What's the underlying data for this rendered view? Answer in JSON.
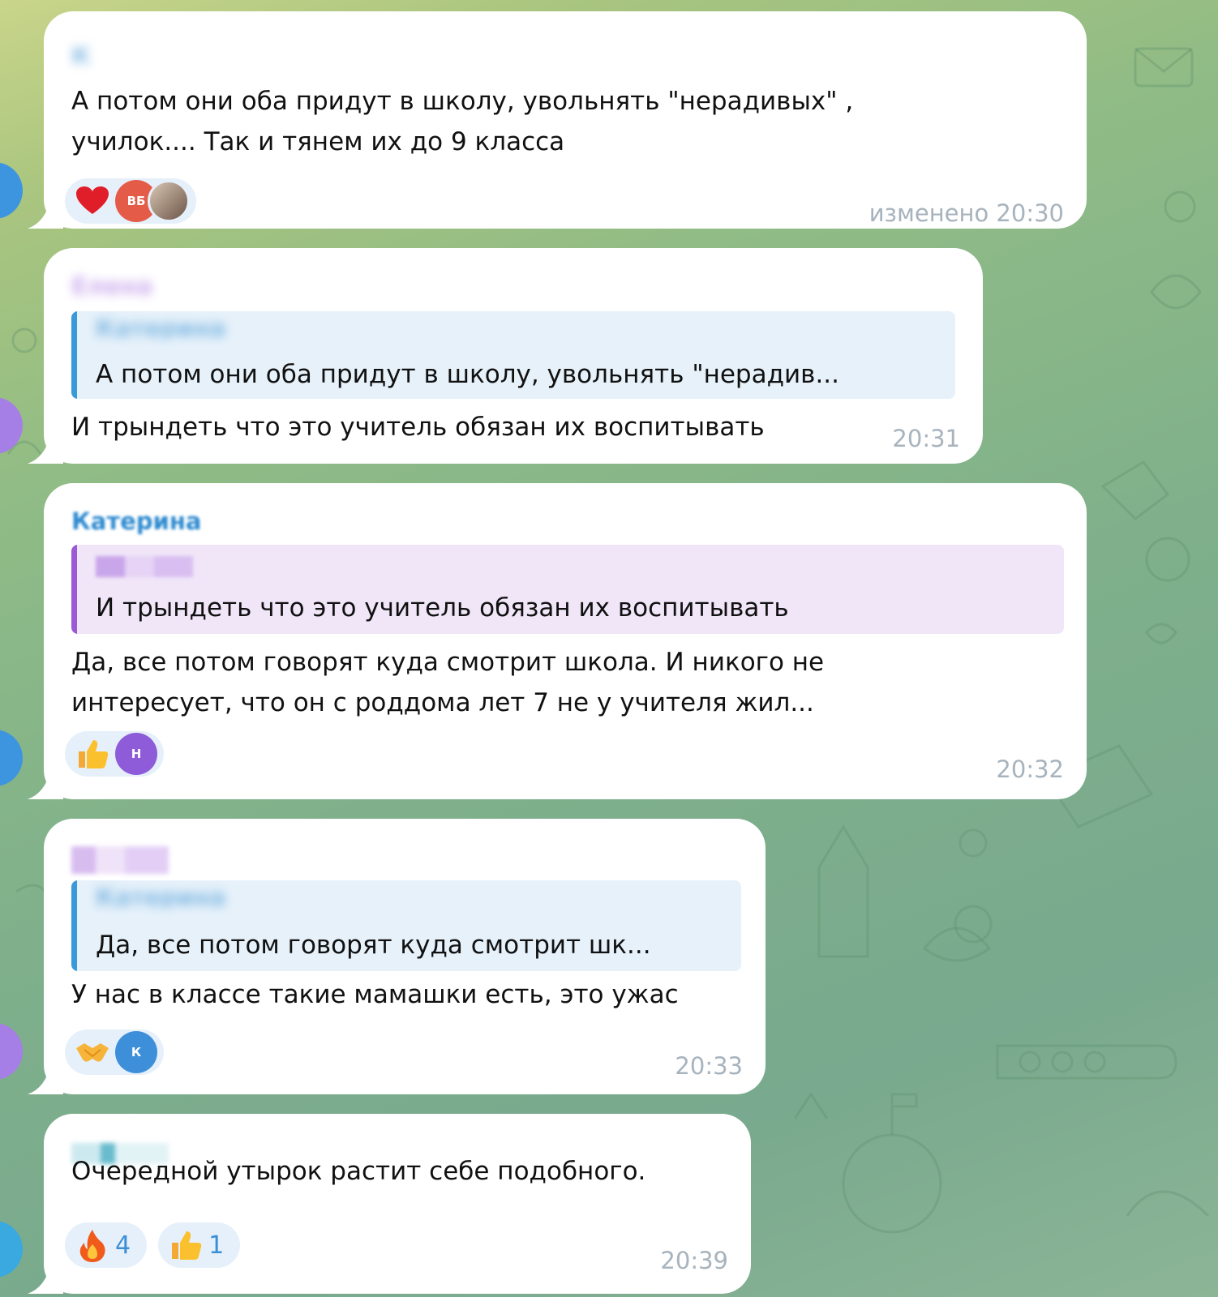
{
  "colors": {
    "bubble": "#ffffff",
    "quote_blue_bg": "#e6f1fa",
    "quote_blue_bar": "#3a9ad9",
    "quote_purple_bg": "#f0e6f8",
    "quote_purple_bar": "#9b59d6",
    "name_blue": "#2e8bd0",
    "name_purple": "#a268e0",
    "name_teal": "#2aa0b8",
    "time": "#a7b3bd",
    "reaction_bg": "#e6f0fa"
  },
  "messages": [
    {
      "sender": "К",
      "text": "А потом они оба придут в школу, увольнять \"нерадивых\" ,\nучилок.... Так и тянем их до 9 класса",
      "reactions": [
        {
          "emoji": "heart-icon",
          "avatars": [
            "ВБ",
            ""
          ]
        }
      ],
      "time": "изменено 20:30"
    },
    {
      "sender": "Елена",
      "quote": {
        "author": "Катерина",
        "text": "А потом они оба придут в школу, увольнять \"нерадив..."
      },
      "text": "И трындеть что это учитель обязан их воспитывать",
      "time": "20:31"
    },
    {
      "sender": "Катерина",
      "quote": {
        "author": "",
        "text": "И трындеть что это учитель обязан их воспитывать"
      },
      "text": "Да, все потом говорят куда смотрит школа. И никого не\nинтересует, что он с роддома лет 7 не у учителя жил...",
      "reactions": [
        {
          "emoji": "thumbs-up-icon",
          "avatars": [
            "Н"
          ]
        }
      ],
      "time": "20:32"
    },
    {
      "sender": "",
      "quote": {
        "author": "Катерина",
        "text": "Да, все потом говорят куда смотрит шк..."
      },
      "text": "У нас в классе такие мамашки есть, это ужас",
      "reactions": [
        {
          "emoji": "handshake-icon",
          "avatars": [
            "К"
          ]
        }
      ],
      "time": "20:33"
    },
    {
      "sender": "",
      "text": "Очередной утырок растит себе подобного.",
      "reactions": [
        {
          "emoji": "fire-icon",
          "count": "4"
        },
        {
          "emoji": "thumbs-up-icon",
          "count": "1"
        }
      ],
      "time": "20:39"
    }
  ]
}
